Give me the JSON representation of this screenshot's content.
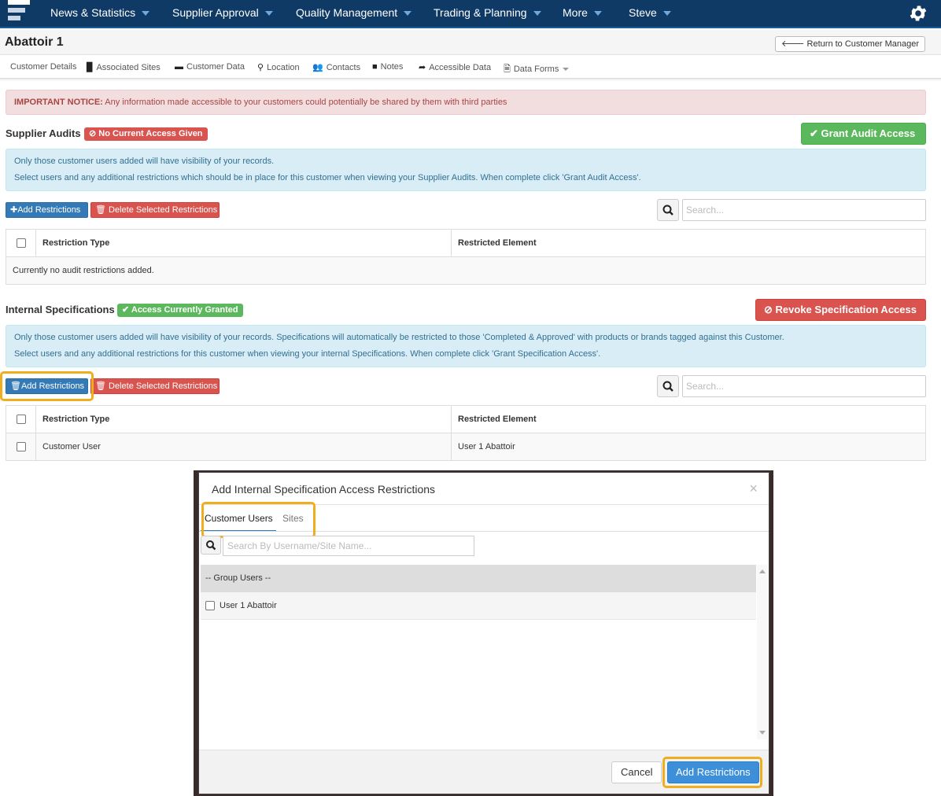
{
  "nav": {
    "items": [
      "News & Statistics",
      "Supplier Approval",
      "Quality Management",
      "Trading & Planning",
      "More",
      "Steve"
    ]
  },
  "title": "Abattoir 1",
  "return_button": "Return to Customer Manager",
  "subnav": [
    "Customer Details",
    "Associated Sites",
    "Customer Data",
    "Location",
    "Contacts",
    "Notes",
    "Accessible Data",
    "Data Forms"
  ],
  "notice": {
    "strong": "IMPORTANT NOTICE:",
    "text": " Any information made accessible to your customers could potentially be shared by them with third parties"
  },
  "audits": {
    "title": "Supplier Audits",
    "status": "No Current Access Given",
    "action": "Grant Audit Access",
    "info1": "Only those customer users added will have visibility of your records.",
    "info2": "Select users and any additional restrictions which should be in place for this customer when viewing your Supplier Audits. When complete click 'Grant Audit Access'.",
    "add_label": "Add Restrictions",
    "delete_label": "Delete Selected Restrictions",
    "search_placeholder": "Search...",
    "col_type": "Restriction Type",
    "col_element": "Restricted Element",
    "empty": "Currently no audit restrictions added."
  },
  "specs": {
    "title": "Internal Specifications",
    "status": "Access Currently Granted",
    "action": "Revoke Specification Access",
    "info1": "Only those customer users added will have visibility of your records. Specifications will automatically be restricted to those 'Completed & Approved' with products or brands tagged against this Customer.",
    "info2": "Select users and any additional restrictions for this customer when viewing your internal Specifications. When complete click 'Grant Specification Access'.",
    "add_label": "Add Restrictions",
    "delete_label": "Delete Selected Restrictions",
    "search_placeholder": "Search...",
    "col_type": "Restriction Type",
    "col_element": "Restricted Element",
    "rows": [
      {
        "type": "Customer User",
        "element": "User 1 Abattoir"
      }
    ]
  },
  "modal": {
    "title": "Add Internal Specification Access Restrictions",
    "close": "×",
    "tabs": [
      "Customer Users",
      "Sites"
    ],
    "search_placeholder": "Search By Username/Site Name...",
    "group": "-- Group Users --",
    "users": [
      "User 1 Abattoir"
    ],
    "cancel": "Cancel",
    "add": "Add Restrictions"
  },
  "colors": {
    "nav_bg": "#0f3a66",
    "danger": "#d9534f",
    "success": "#5cb85c",
    "primary": "#337ab7",
    "highlight": "#f0ad1e"
  }
}
